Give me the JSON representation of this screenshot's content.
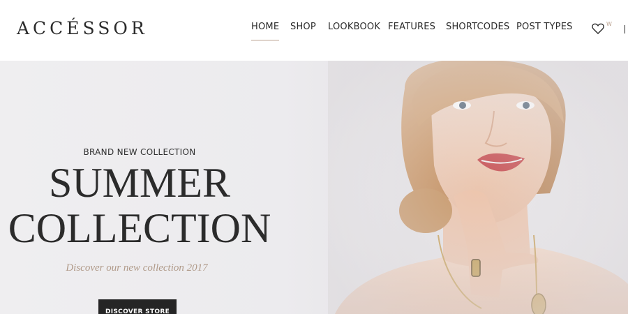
{
  "brand": {
    "logo_text": "ACCÉSSOR"
  },
  "nav": {
    "items": [
      {
        "label": "HOME",
        "active": true
      },
      {
        "label": "SHOP"
      },
      {
        "label": "LOOKBOOK"
      },
      {
        "label": "FEATURES"
      },
      {
        "label": "SHORTCODES"
      },
      {
        "label": "POST TYPES"
      }
    ]
  },
  "header_actions": {
    "wishlist_icon": "heart-outline",
    "wishlist_badge": "W"
  },
  "hero": {
    "eyebrow": "BRAND NEW COLLECTION",
    "headline_line1": "SUMMER",
    "headline_line2": "COLLECTION",
    "tagline": "Discover our new collection 2017",
    "cta_label": "DISCOVER STORE",
    "photo": "model-portrait"
  },
  "colors": {
    "accent": "#b9a08e",
    "text_dark": "#2b2b2b",
    "cta_bg": "#252525",
    "hero_bg": "#ecebee"
  }
}
